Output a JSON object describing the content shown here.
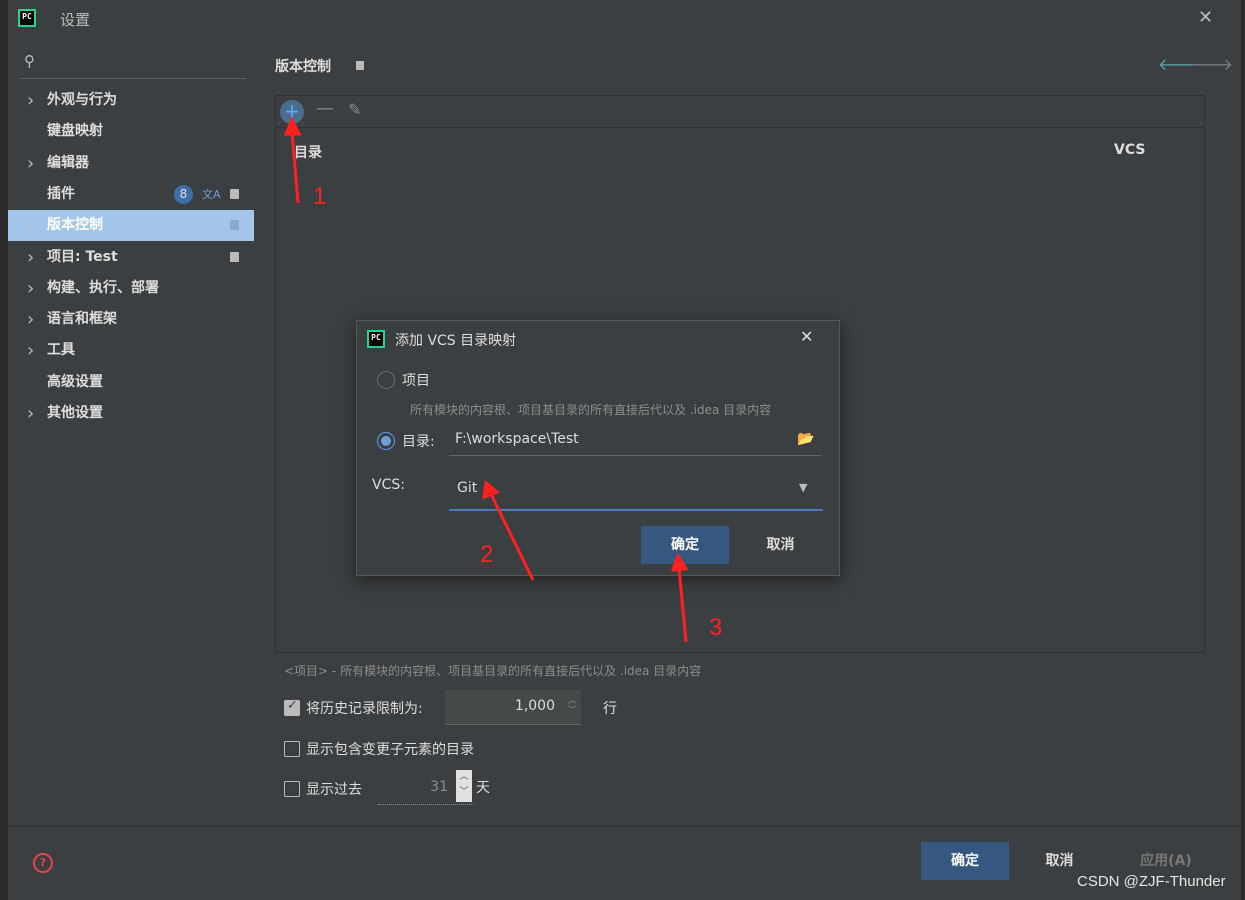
{
  "window": {
    "title": "设置",
    "close_icon": "✕"
  },
  "sidebar": {
    "search_placeholder": "",
    "items": [
      {
        "label": "外观与行为",
        "chevron": true
      },
      {
        "label": "键盘映射",
        "chevron": false
      },
      {
        "label": "编辑器",
        "chevron": true
      },
      {
        "label": "插件",
        "chevron": false,
        "badge": "8"
      },
      {
        "label": "版本控制",
        "chevron": true,
        "selected": true
      },
      {
        "label": "项目: Test",
        "chevron": true
      },
      {
        "label": "构建、执行、部署",
        "chevron": true
      },
      {
        "label": "语言和框架",
        "chevron": true
      },
      {
        "label": "工具",
        "chevron": true
      },
      {
        "label": "高级设置",
        "chevron": false
      },
      {
        "label": "其他设置",
        "chevron": true
      }
    ]
  },
  "main": {
    "section_title": "版本控制",
    "table": {
      "columns": [
        "目录",
        "VCS"
      ]
    },
    "hint": "<项目> - 所有模块的内容根、项目基目录的所有直接后代以及 .idea 目录内容",
    "history_limit": {
      "label": "将历史记录限制为:",
      "value": "1,000",
      "unit": "行",
      "checked": true
    },
    "show_dirs": {
      "label": "显示包含变更子元素的目录",
      "checked": false
    },
    "show_past": {
      "label": "显示过去",
      "value": "31",
      "unit": "天",
      "checked": false
    }
  },
  "dialog": {
    "title": "添加 VCS 目录映射",
    "option_project": "项目",
    "project_desc": "所有模块的内容根、项目基目录的所有直接后代以及 .idea 目录内容",
    "option_dir": "目录:",
    "dir_value": "F:\\workspace\\Test",
    "vcs_label": "VCS:",
    "vcs_value": "Git",
    "ok": "确定",
    "cancel": "取消"
  },
  "bottom": {
    "ok": "确定",
    "cancel": "取消",
    "apply": "应用(A)",
    "help": "?"
  },
  "annotations": [
    "1",
    "2",
    "3"
  ],
  "watermark": "CSDN @ZJF-Thunder",
  "colors": {
    "accent": "#365880",
    "selected_nav": "#a4c5ea",
    "annotation": "#ff2020"
  }
}
